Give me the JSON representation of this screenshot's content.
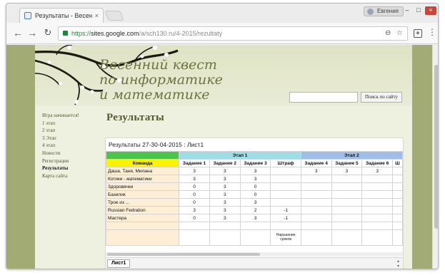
{
  "browser": {
    "tab_title": "Результаты - Весенний",
    "tab_close": "×",
    "profile_label": "Евгения",
    "win_min": "–",
    "win_max": "□",
    "win_close": "×",
    "back": "←",
    "forward": "→",
    "reload": "↻",
    "url_https": "https://",
    "url_host": "sites.google.com",
    "url_path": "/a/sch130.ru/4-2015/rezultaty",
    "zoom_icon": "⊖",
    "star_icon": "☆",
    "ext_icon": "◈",
    "menu_icon": "⋮"
  },
  "site": {
    "title_lines": [
      "Весенний квест",
      "по информатике",
      "и математике"
    ],
    "search_placeholder": "",
    "search_button": "Поиск по сайту",
    "nav": [
      {
        "label": "Игра начинается!",
        "active": false
      },
      {
        "label": "1 этап",
        "active": false
      },
      {
        "label": "2 этап",
        "active": false
      },
      {
        "label": "3 Этап",
        "active": false
      },
      {
        "label": "4 этап",
        "active": false
      },
      {
        "label": "Новости",
        "active": false
      },
      {
        "label": "Регистрация",
        "active": false
      },
      {
        "label": "Результаты",
        "active": true
      },
      {
        "label": "Карта сайта",
        "active": false
      }
    ],
    "heading": "Результаты"
  },
  "sheet": {
    "title": "Результаты 27-30-04-2015 : Лист1",
    "group_row": [
      "",
      "Этап 1",
      "Этап 2"
    ],
    "header_row": [
      "Команда",
      "Задание 1",
      "Задание 2",
      "Задание 3",
      "Штраф",
      "Задание 4",
      "Задание 5",
      "Задание 6",
      "Ш"
    ],
    "rows": [
      [
        "Даша, Таня, Милана",
        "3",
        "3",
        "3",
        "",
        "3",
        "3",
        "3",
        ""
      ],
      [
        "Котики - математики",
        "3",
        "3",
        "3",
        "",
        "",
        "",
        "",
        ""
      ],
      [
        "Здоровячки",
        "0",
        "3",
        "0",
        "",
        "",
        "",
        "",
        ""
      ],
      [
        "Базилик",
        "0",
        "3",
        "0",
        "",
        "",
        "",
        "",
        ""
      ],
      [
        "Трое из ...",
        "0",
        "3",
        "3",
        "",
        "",
        "",
        "",
        ""
      ],
      [
        "Russian Fedration",
        "3",
        "3",
        "2",
        "-1",
        "",
        "",
        "",
        ""
      ],
      [
        "Мастера",
        "0",
        "3",
        "3",
        "-1",
        "",
        "",
        "",
        ""
      ],
      [
        "",
        "",
        "",
        "",
        "",
        "",
        "",
        "",
        ""
      ],
      [
        "",
        "",
        "",
        "",
        "Нарушение сроков",
        "",
        "",
        "",
        ""
      ]
    ],
    "tab_label": "Лист1",
    "arrow_up": "▴",
    "arrow_down": "▾"
  },
  "colors": {
    "page_bg": "#a3ab74",
    "header_green": "#4cc34c",
    "stage1": "#9fdde6",
    "stage2": "#9fbde6",
    "team_header": "#fff200",
    "team_cell": "#fdeed5"
  }
}
